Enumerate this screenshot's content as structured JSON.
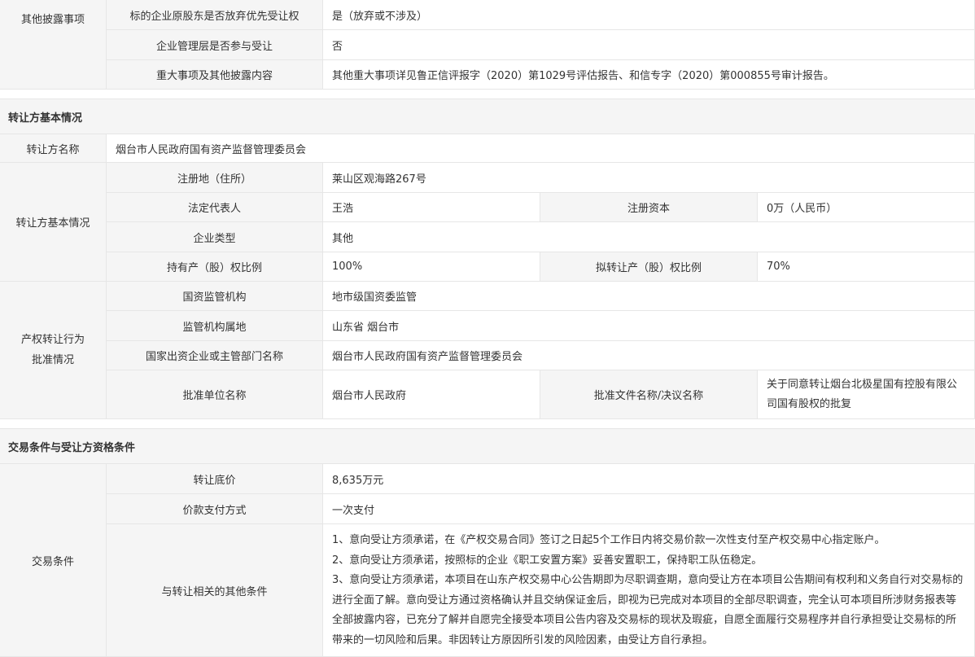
{
  "disclosure": {
    "group_label": "其他披露事项",
    "rows": [
      {
        "label": "标的企业原股东是否放弃优先受让权",
        "value": "是（放弃或不涉及）"
      },
      {
        "label": "企业管理层是否参与受让",
        "value": "否"
      },
      {
        "label": "重大事项及其他披露内容",
        "value": "其他重大事项详见鲁正信评报字（2020）第1029号评估报告、和信专字（2020）第000855号审计报告。"
      }
    ]
  },
  "transferor": {
    "section_title": "转让方基本情况",
    "name_label": "转让方名称",
    "name_value": "烟台市人民政府国有资产监督管理委员会",
    "basic_group_label": "转让方基本情况",
    "address_label": "注册地（住所）",
    "address_value": "莱山区观海路267号",
    "legal_rep_label": "法定代表人",
    "legal_rep_value": "王浩",
    "capital_label": "注册资本",
    "capital_value": "0万（人民币）",
    "type_label": "企业类型",
    "type_value": "其他",
    "holding_label": "持有产（股）权比例",
    "holding_value": "100%",
    "planned_label": "拟转让产（股）权比例",
    "planned_value": "70%",
    "approval_group_label": "产权转让行为批准情况",
    "supervisor_label": "国资监管机构",
    "supervisor_value": "地市级国资委监管",
    "location_label": "监管机构属地",
    "location_value": "山东省 烟台市",
    "dept_label": "国家出资企业或主管部门名称",
    "dept_value": "烟台市人民政府国有资产监督管理委员会",
    "approver_label": "批准单位名称",
    "approver_value": "烟台市人民政府",
    "doc_label": "批准文件名称/决议名称",
    "doc_value": "关于同意转让烟台北极星国有控股有限公司国有股权的批复"
  },
  "trade": {
    "section_title": "交易条件与受让方资格条件",
    "group_label": "交易条件",
    "price_label": "转让底价",
    "price_value": "8,635万元",
    "payment_label": "价款支付方式",
    "payment_value": "一次支付",
    "other_label": "与转让相关的其他条件",
    "other_items": [
      "1、意向受让方须承诺，在《产权交易合同》签订之日起5个工作日内将交易价款一次性支付至产权交易中心指定账户。",
      "2、意向受让方须承诺，按照标的企业《职工安置方案》妥善安置职工，保持职工队伍稳定。",
      "3、意向受让方须承诺，本项目在山东产权交易中心公告期即为尽职调查期，意向受让方在本项目公告期间有权利和义务自行对交易标的进行全面了解。意向受让方通过资格确认并且交纳保证金后，即视为已完成对本项目的全部尽职调查，完全认可本项目所涉财务报表等全部披露内容，已充分了解并自愿完全接受本项目公告内容及交易标的现状及瑕疵，自愿全面履行交易程序并自行承担受让交易标的所带来的一切风险和后果。非因转让方原因所引发的风险因素，由受让方自行承担。"
    ]
  }
}
